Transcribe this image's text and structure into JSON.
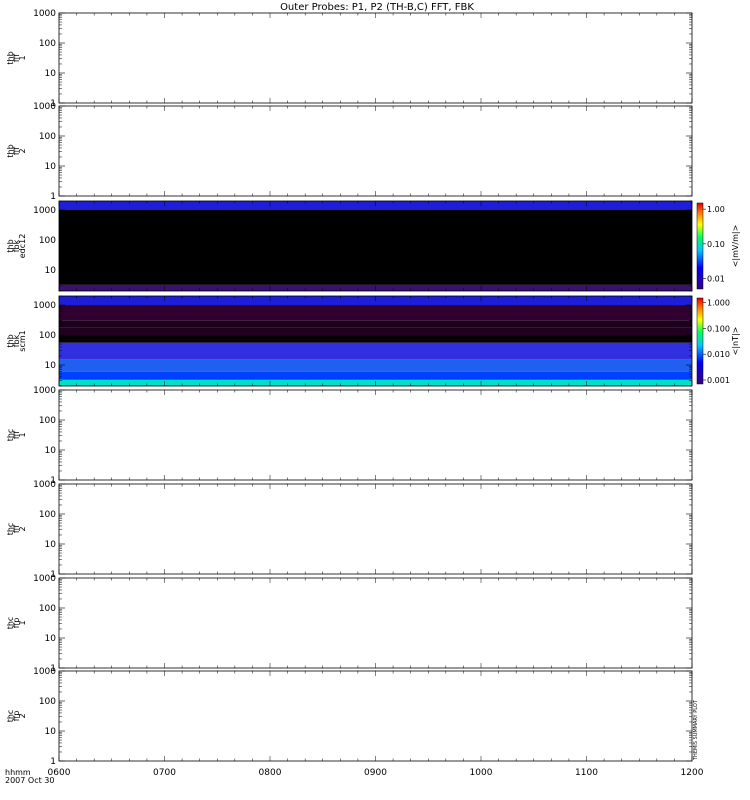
{
  "title": "Outer Probes: P1, P2 (TH-B,C) FFT, FBK",
  "footer": {
    "time_label": "hhmm",
    "date_label": "2007 Oct 30"
  },
  "side_note": "THEMIS SUMMARY PLOT",
  "chart_data": [
    {
      "type": "line",
      "panel": 1,
      "ylabel": [
        "thb",
        "fff",
        "1"
      ],
      "yscale": "log",
      "ylim": [
        1,
        1000
      ],
      "yticks": [
        "1",
        "10",
        "100",
        "1000"
      ],
      "series": []
    },
    {
      "type": "line",
      "panel": 2,
      "ylabel": [
        "thb",
        "fff",
        "2"
      ],
      "yscale": "log",
      "ylim": [
        1,
        1000
      ],
      "yticks": [
        "1",
        "10",
        "100",
        "1000"
      ],
      "series": []
    },
    {
      "type": "heatmap",
      "panel": 3,
      "ylabel": [
        "thb",
        "fbk",
        "edc12"
      ],
      "yscale": "log",
      "ylim": [
        2,
        2000
      ],
      "yticks": [
        "10",
        "100",
        "1000"
      ],
      "colorbar": {
        "label": "<|mV/m|>",
        "scale": "log",
        "range": [
          0.005,
          1.5
        ],
        "ticks": [
          "0.01",
          "0.10",
          "1.00"
        ]
      },
      "bands": [
        {
          "y": [
            1000,
            2000
          ],
          "color": "#1e1ed8"
        },
        {
          "y": [
            3.2,
            1000
          ],
          "color": "#000000"
        },
        {
          "y": [
            2,
            3.2
          ],
          "color": "#3a1070"
        }
      ]
    },
    {
      "type": "heatmap",
      "panel": 4,
      "ylabel": [
        "thb",
        "fbk",
        "scm1"
      ],
      "yscale": "log",
      "ylim": [
        2,
        2000
      ],
      "yticks": [
        "10",
        "100",
        "1000"
      ],
      "colorbar": {
        "label": "<|nT|>",
        "scale": "log",
        "range": [
          0.0007,
          1.5
        ],
        "ticks": [
          "0.001",
          "0.010",
          "0.100",
          "1.000"
        ]
      },
      "bands": [
        {
          "y": [
            1000,
            2000
          ],
          "color": "#1e1ed8"
        },
        {
          "y": [
            300,
            1000
          ],
          "color": "#300030"
        },
        {
          "y": [
            180,
            300
          ],
          "color": "#1a0018"
        },
        {
          "y": [
            100,
            180
          ],
          "color": "#220020"
        },
        {
          "y": [
            55,
            100
          ],
          "color": "#050005"
        },
        {
          "y": [
            15,
            55
          ],
          "color": "#3030e0"
        },
        {
          "y": [
            6,
            15
          ],
          "color": "#2060f0"
        },
        {
          "y": [
            3.2,
            6
          ],
          "color": "#0040ff"
        },
        {
          "y": [
            2,
            3.2
          ],
          "color": "#00e0c8"
        }
      ]
    },
    {
      "type": "line",
      "panel": 5,
      "ylabel": [
        "thc",
        "fff",
        "1"
      ],
      "yscale": "log",
      "ylim": [
        1,
        1000
      ],
      "yticks": [
        "1",
        "10",
        "100",
        "1000"
      ],
      "series": []
    },
    {
      "type": "line",
      "panel": 6,
      "ylabel": [
        "thc",
        "fff",
        "2"
      ],
      "yscale": "log",
      "ylim": [
        1,
        1000
      ],
      "yticks": [
        "1",
        "10",
        "100",
        "1000"
      ],
      "series": []
    },
    {
      "type": "line",
      "panel": 7,
      "ylabel": [
        "thc",
        "ffp",
        "1"
      ],
      "yscale": "log",
      "ylim": [
        1,
        1000
      ],
      "yticks": [
        "1",
        "10",
        "100",
        "1000"
      ],
      "series": []
    },
    {
      "type": "line",
      "panel": 8,
      "ylabel": [
        "thc",
        "ffp",
        "2"
      ],
      "yscale": "log",
      "ylim": [
        1,
        1000
      ],
      "yticks": [
        "1",
        "10",
        "100",
        "1000"
      ],
      "series": []
    }
  ],
  "x_axis": {
    "ticks": [
      "0600",
      "0700",
      "0800",
      "0900",
      "1000",
      "1100",
      "1200"
    ],
    "range": [
      0,
      6
    ]
  }
}
